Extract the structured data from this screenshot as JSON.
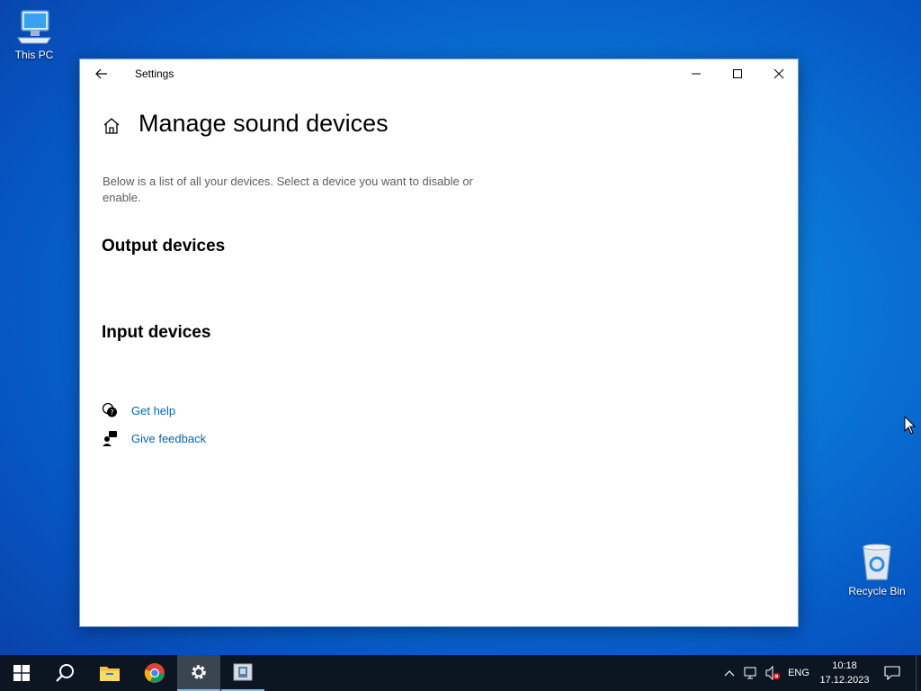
{
  "desktop": {
    "icons": [
      {
        "label": "This PC",
        "icon": "computer-icon"
      },
      {
        "label": "Recycle Bin",
        "icon": "recycle-bin-icon"
      }
    ]
  },
  "window": {
    "title": "Settings",
    "controls": {
      "minimize": "minimize-icon",
      "maximize": "maximize-icon",
      "close": "close-icon"
    },
    "page_title": "Manage sound devices",
    "description": "Below is a list of all your devices. Select a device you want to disable or enable.",
    "sections": {
      "output": "Output devices",
      "input": "Input devices"
    },
    "links": {
      "help": "Get help",
      "feedback": "Give feedback"
    },
    "accent_color": "#0067b8"
  },
  "taskbar": {
    "pinned": [
      "start-icon",
      "search-icon",
      "file-explorer-icon",
      "chrome-icon",
      "settings-icon",
      "app-icon"
    ],
    "tray": {
      "language": "ENG",
      "time": "10:18",
      "date": "17.12.2023"
    }
  }
}
